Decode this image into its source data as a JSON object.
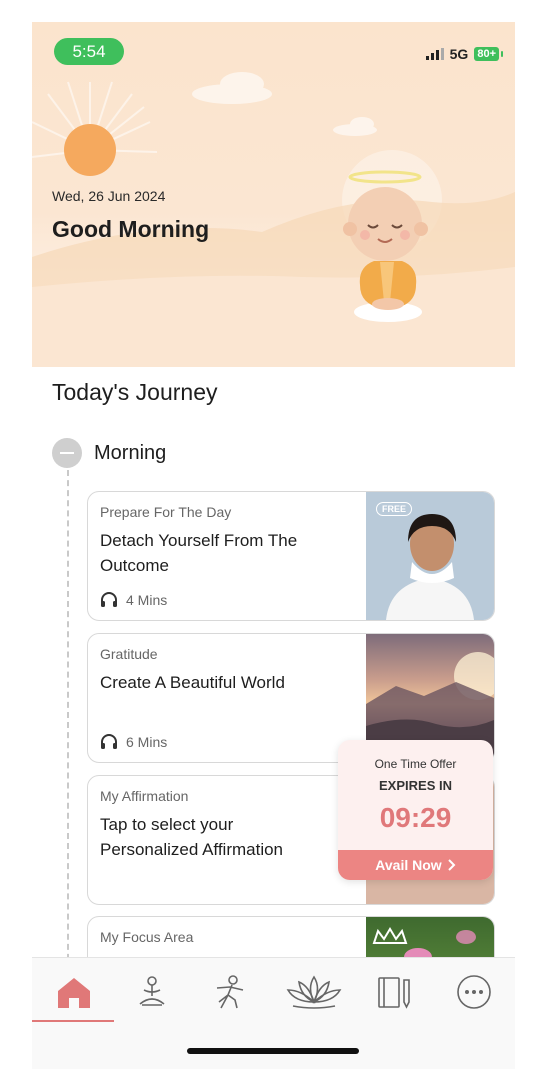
{
  "status_bar": {
    "time": "5:54",
    "network": "5G",
    "battery": "80+"
  },
  "header": {
    "date": "Wed, 26 Jun 2024",
    "greeting": "Good Morning"
  },
  "journey": {
    "title": "Today's Journey",
    "period": "Morning",
    "cards": [
      {
        "category": "Prepare For The Day",
        "title": "Detach Yourself From The Outcome",
        "duration": "4 Mins",
        "badge": "FREE"
      },
      {
        "category": "Gratitude",
        "title": "Create A Beautiful World",
        "duration": "6 Mins"
      },
      {
        "category": "My Affirmation",
        "title": "Tap to select your Personalized Affirmation"
      },
      {
        "category": "My Focus Area",
        "title": ""
      }
    ]
  },
  "offer": {
    "line1": "One Time Offer",
    "line2": "EXPIRES IN",
    "countdown": "09:29",
    "button": "Avail Now"
  },
  "tabbar": {
    "tabs": [
      "home-icon",
      "meditation-icon",
      "yoga-icon",
      "lotus-icon",
      "journal-icon",
      "more-icon"
    ],
    "active_index": 0,
    "accent_color": "#e07878"
  },
  "colors": {
    "accent": "#ec8583",
    "hero_bg": "#fbe4cd",
    "time_pill": "#3fbf5c"
  }
}
